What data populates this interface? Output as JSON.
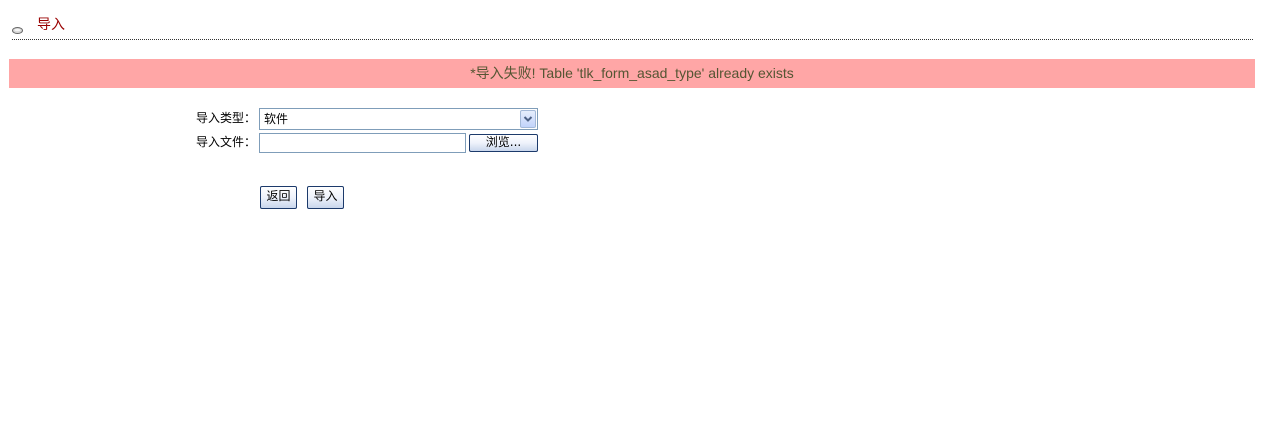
{
  "header": {
    "title": "导入",
    "icon": "disc-icon"
  },
  "alert": {
    "message": "*导入失败! Table 'tlk_form_asad_type' already exists",
    "background": "#ffa6a6"
  },
  "form": {
    "type_label": "导入类型：",
    "type_value": "软件",
    "file_label": "导入文件：",
    "file_value": "",
    "browse_label": "浏览..."
  },
  "actions": {
    "back_label": "返回",
    "import_label": "导入"
  }
}
